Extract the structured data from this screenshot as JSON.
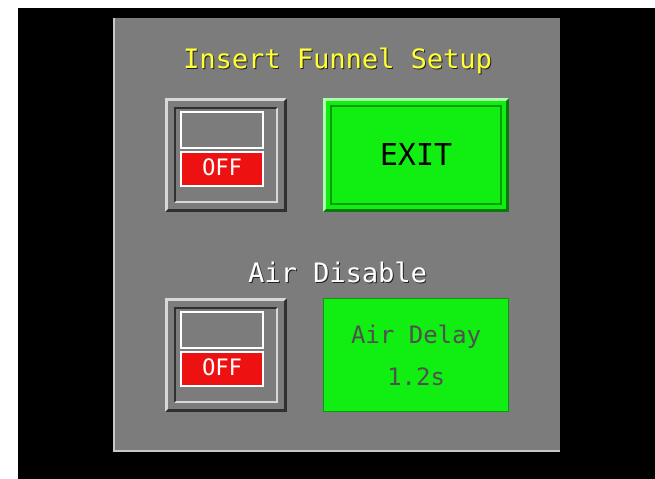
{
  "title": "Insert Funnel Setup",
  "toggle_top": {
    "state": "OFF"
  },
  "exit_button": {
    "label": "EXIT"
  },
  "section_label": "Air Disable",
  "toggle_bottom": {
    "state": "OFF"
  },
  "air_delay": {
    "label": "Air Delay",
    "value": "1.2s"
  },
  "colors": {
    "panel": "#7c7c7c",
    "title": "#ffff33",
    "button_green": "#11ee11",
    "off_red": "#ee1111",
    "background": "#000000"
  }
}
